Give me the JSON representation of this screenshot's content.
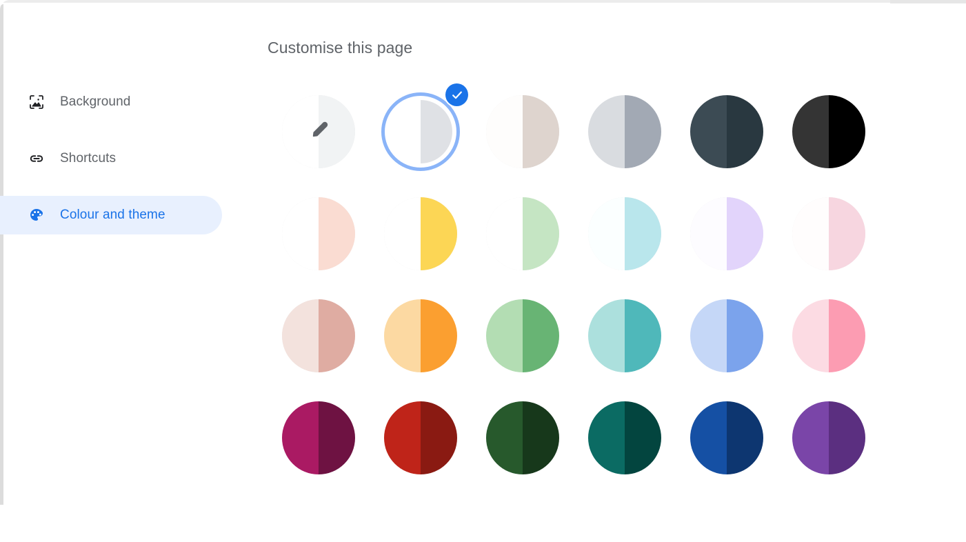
{
  "dialog": {
    "title": "Customise this page"
  },
  "sidebar": {
    "items": [
      {
        "label": "Background",
        "icon": "image-icon",
        "active": false
      },
      {
        "label": "Shortcuts",
        "icon": "link-icon",
        "active": false
      },
      {
        "label": "Colour and theme",
        "icon": "palette-icon",
        "active": true
      }
    ]
  },
  "colors": {
    "accent": "#1a73e8",
    "accent_ring": "#8ab4f8",
    "active_pill_bg": "#e8f0fe",
    "text_muted": "#5f6368"
  },
  "swatches": {
    "selected_index": 1,
    "items": [
      {
        "name": "custom-colour-picker",
        "left": "#ffffff",
        "right": "#f1f3f4",
        "border": true,
        "icon": "eyedropper-icon"
      },
      {
        "name": "default-light",
        "left": "#ffffff",
        "right": "#dfe1e5",
        "border": false,
        "icon": null
      },
      {
        "name": "warm-grey",
        "left": "#fefdfc",
        "right": "#ded4ce",
        "border": true,
        "icon": null
      },
      {
        "name": "cool-grey",
        "left": "#d9dce0",
        "right": "#a2a9b4",
        "border": false,
        "icon": null
      },
      {
        "name": "dark-slate",
        "left": "#3c4b54",
        "right": "#293840",
        "border": false,
        "icon": null
      },
      {
        "name": "black",
        "left": "#343434",
        "right": "#000000",
        "border": false,
        "icon": null
      },
      {
        "name": "pale-peach",
        "left": "#ffffff",
        "right": "#fadcd2",
        "border": true,
        "icon": null
      },
      {
        "name": "yellow",
        "left": "#ffffff",
        "right": "#fcd655",
        "border": true,
        "icon": null
      },
      {
        "name": "pale-green",
        "left": "#ffffff",
        "right": "#c5e5c3",
        "border": true,
        "icon": null
      },
      {
        "name": "pale-cyan",
        "left": "#fbffff",
        "right": "#b9e6ec",
        "border": true,
        "icon": null
      },
      {
        "name": "pale-lavender",
        "left": "#fdfcff",
        "right": "#e2d4fb",
        "border": true,
        "icon": null
      },
      {
        "name": "pale-pink",
        "left": "#fffdfd",
        "right": "#f7d6e0",
        "border": true,
        "icon": null
      },
      {
        "name": "dusty-rose",
        "left": "#f3e2dd",
        "right": "#dfaca2",
        "border": true,
        "icon": null
      },
      {
        "name": "orange",
        "left": "#fcd9a2",
        "right": "#fb9f30",
        "border": false,
        "icon": null
      },
      {
        "name": "green",
        "left": "#b3ddb3",
        "right": "#68b474",
        "border": false,
        "icon": null
      },
      {
        "name": "teal",
        "left": "#ace0dd",
        "right": "#4fb8ba",
        "border": false,
        "icon": null
      },
      {
        "name": "periwinkle",
        "left": "#c5d7f7",
        "right": "#7ba3ec",
        "border": false,
        "icon": null
      },
      {
        "name": "pink",
        "left": "#fcdbe3",
        "right": "#fc9cb2",
        "border": false,
        "icon": null
      },
      {
        "name": "dark-magenta",
        "left": "#aa1a63",
        "right": "#6e1242",
        "border": false,
        "icon": null
      },
      {
        "name": "dark-red",
        "left": "#bf2419",
        "right": "#8a1a12",
        "border": false,
        "icon": null
      },
      {
        "name": "dark-green",
        "left": "#27592c",
        "right": "#17381b",
        "border": false,
        "icon": null
      },
      {
        "name": "dark-teal",
        "left": "#0b6b63",
        "right": "#03453f",
        "border": false,
        "icon": null
      },
      {
        "name": "dark-blue",
        "left": "#1550a4",
        "right": "#0d3670",
        "border": false,
        "icon": null
      },
      {
        "name": "dark-purple",
        "left": "#7a45a8",
        "right": "#5b2f80",
        "border": false,
        "icon": null
      }
    ]
  }
}
